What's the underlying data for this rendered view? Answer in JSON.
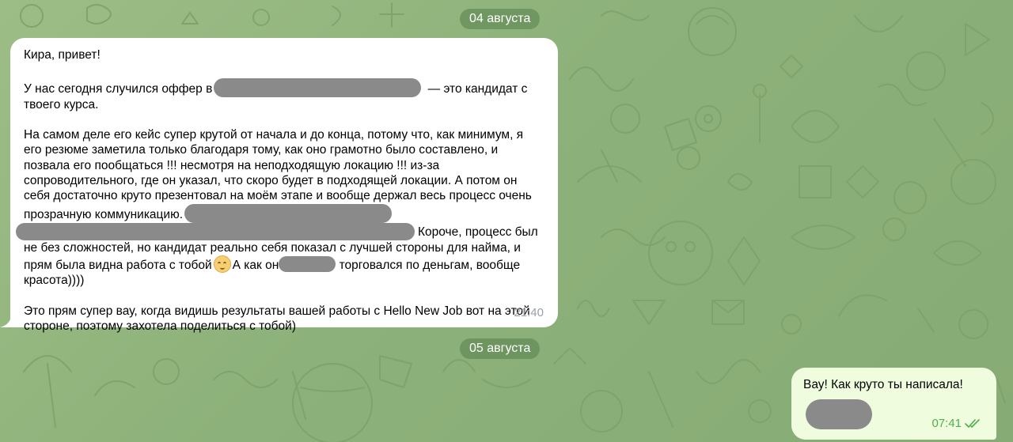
{
  "dates": {
    "first": "04 августа",
    "second": "05 августа"
  },
  "incoming_message": {
    "greeting": "Кира, привет!",
    "p2_a": "У нас сегодня случился оффер в",
    "p2_b": " — это кандидат с твоего курса.",
    "p3_a": "На самом деле его кейс супер крутой от начала и до конца, потому что, как минимум, я его резюме заметила только благодаря тому, как оно грамотно было составлено, и позвала его пообщаться !!! несмотря на неподходящую локацию !!! из-за сопроводительного, где он указал, что скоро будет в подходящей локации. А потом он себя достаточно круто презентовал на моём этапе и вообще держал весь процесс очень прозрачную коммуникацию.",
    "p3_b": "Короче, процесс был не без сложностей, но кандидат реально себя показал с лучшей стороны для найма, и прям была видна работа с тобой",
    "p3_c": "А как он",
    "p3_d": "торговался по деньгам, вообще красота))))",
    "p4": "Это прям супер вау, когда видишь результаты вашей работы с Hello New Job вот на этой стороне, поэтому захотела поделиться с тобой)",
    "time": "21:40",
    "emoji": "smiling-face-icon"
  },
  "outgoing_message": {
    "text": "Вау! Как круто ты написала!",
    "time": "07:41",
    "status_icon": "double-check-icon",
    "status_color": "#4fae4e"
  },
  "colors": {
    "background": "#8fb27b",
    "incoming_bubble": "#ffffff",
    "outgoing_bubble": "#effdde",
    "redaction": "#8a8a8a"
  }
}
